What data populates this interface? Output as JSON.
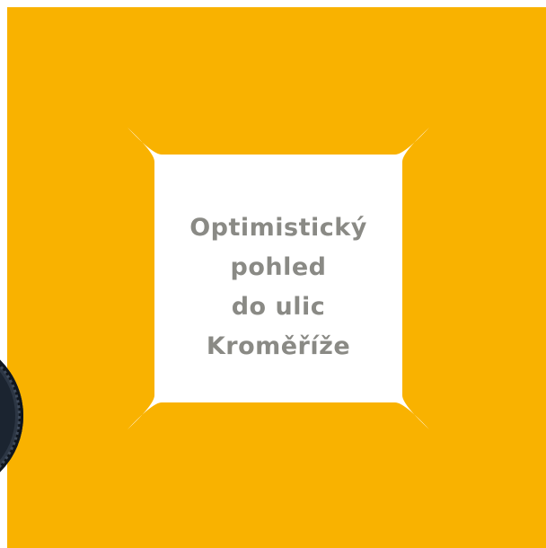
{
  "headline": {
    "lines": [
      "Optimistický",
      "pohled",
      "do ulic",
      "Kroměříže"
    ]
  },
  "colors": {
    "background": "#f9b200",
    "badge": "#ffffff",
    "text": "#8a8a85"
  },
  "icons": {
    "badge": "square-speech-badge",
    "tire": "bicycle-tire-fragment"
  }
}
